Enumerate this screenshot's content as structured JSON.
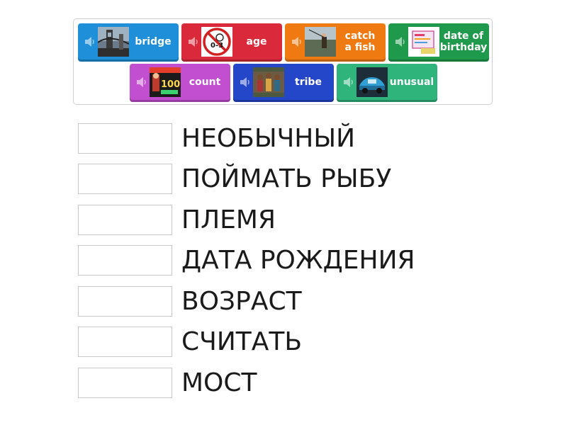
{
  "cards": [
    {
      "label": "bridge",
      "color": "#1e8fd8",
      "icon": "speaker-icon",
      "image": "bridge-photo"
    },
    {
      "label": "age",
      "color": "#d9293b",
      "icon": "speaker-icon",
      "image": "age-restriction-sign",
      "image_text": "0-3"
    },
    {
      "label": "catch\na fish",
      "color": "#f07a12",
      "icon": "speaker-icon",
      "image": "fisherman-photo"
    },
    {
      "label": "date of\nbirthday",
      "color": "#1f9a4c",
      "icon": "speaker-icon",
      "image": "birthday-card"
    },
    {
      "label": "count",
      "color": "#c24fd0",
      "icon": "speaker-icon",
      "image": "counting-100-poster",
      "image_text": "100"
    },
    {
      "label": "tribe",
      "color": "#2446c9",
      "icon": "speaker-icon",
      "image": "tribe-photo"
    },
    {
      "label": "unusual",
      "color": "#2fb47c",
      "icon": "speaker-icon",
      "image": "unusual-car-photo"
    }
  ],
  "targets": [
    {
      "term": "НЕОБЫЧНЫЙ"
    },
    {
      "term": "ПОЙМАТЬ РЫБУ"
    },
    {
      "term": "ПЛЕМЯ"
    },
    {
      "term": "ДАТА РОЖДЕНИЯ"
    },
    {
      "term": "ВОЗРАСТ"
    },
    {
      "term": "СЧИТАТЬ"
    },
    {
      "term": "МОСТ"
    }
  ]
}
